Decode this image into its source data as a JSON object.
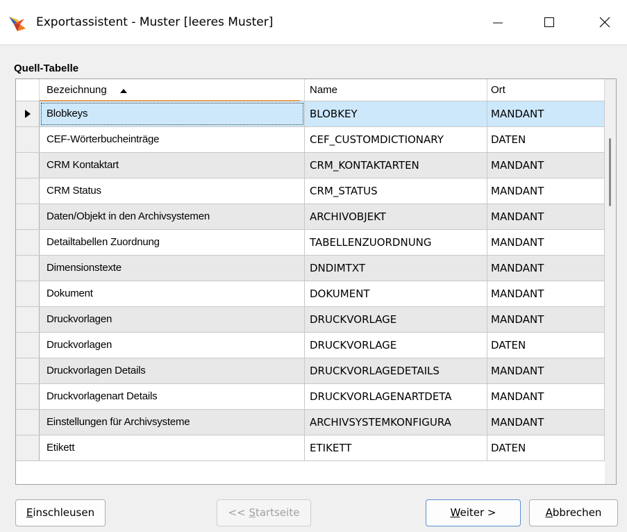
{
  "window": {
    "title": "Exportassistent - Muster [leeres Muster]",
    "app_icon": "star-cursor-icon"
  },
  "section": {
    "label": "Quell-Tabelle"
  },
  "table": {
    "columns": [
      "Bezeichnung",
      "Name",
      "Ort"
    ],
    "sort_column": "Bezeichnung",
    "sort_direction": "ascending",
    "selected_index": 0,
    "rows": [
      {
        "bezeichnung": "Blobkeys",
        "name": "BLOBKEY",
        "ort": "MANDANT"
      },
      {
        "bezeichnung": "CEF-Wörterbucheinträge",
        "name": "CEF_CUSTOMDICTIONARY",
        "ort": "DATEN"
      },
      {
        "bezeichnung": "CRM Kontaktart",
        "name": "CRM_KONTAKTARTEN",
        "ort": "MANDANT"
      },
      {
        "bezeichnung": "CRM Status",
        "name": "CRM_STATUS",
        "ort": "MANDANT"
      },
      {
        "bezeichnung": "Daten/Objekt in den Archivsystemen",
        "name": "ARCHIVOBJEKT",
        "ort": "MANDANT"
      },
      {
        "bezeichnung": "Detailtabellen Zuordnung",
        "name": "TABELLENZUORDNUNG",
        "ort": "MANDANT"
      },
      {
        "bezeichnung": "Dimensionstexte",
        "name": "DNDIMTXT",
        "ort": "MANDANT"
      },
      {
        "bezeichnung": "Dokument",
        "name": "DOKUMENT",
        "ort": "MANDANT"
      },
      {
        "bezeichnung": "Druckvorlagen",
        "name": "DRUCKVORLAGE",
        "ort": "MANDANT"
      },
      {
        "bezeichnung": "Druckvorlagen",
        "name": "DRUCKVORLAGE",
        "ort": "DATEN"
      },
      {
        "bezeichnung": "Druckvorlagen Details",
        "name": "DRUCKVORLAGEDETAILS",
        "ort": "MANDANT"
      },
      {
        "bezeichnung": "Druckvorlagenart Details",
        "name": "DRUCKVORLAGENARTDETA",
        "ort": "MANDANT"
      },
      {
        "bezeichnung": "Einstellungen für Archivsysteme",
        "name": "ARCHIVSYSTEMKONFIGURA",
        "ort": "MANDANT"
      },
      {
        "bezeichnung": "Etikett",
        "name": "ETIKETT",
        "ort": "DATEN"
      }
    ]
  },
  "buttons": {
    "einschleusen": {
      "mnemonic": "E",
      "rest": "inschleusen"
    },
    "startseite": {
      "prefix": "<< ",
      "mnemonic": "S",
      "rest": "tartseite",
      "enabled": false
    },
    "weiter": {
      "mnemonic": "W",
      "rest": "eiter >"
    },
    "abbrechen": {
      "mnemonic": "A",
      "rest": "bbrechen"
    }
  },
  "colors": {
    "selection": "#cde8fb",
    "alt_row": "#e8e8e8",
    "sort_indicator": "#e8a060"
  }
}
